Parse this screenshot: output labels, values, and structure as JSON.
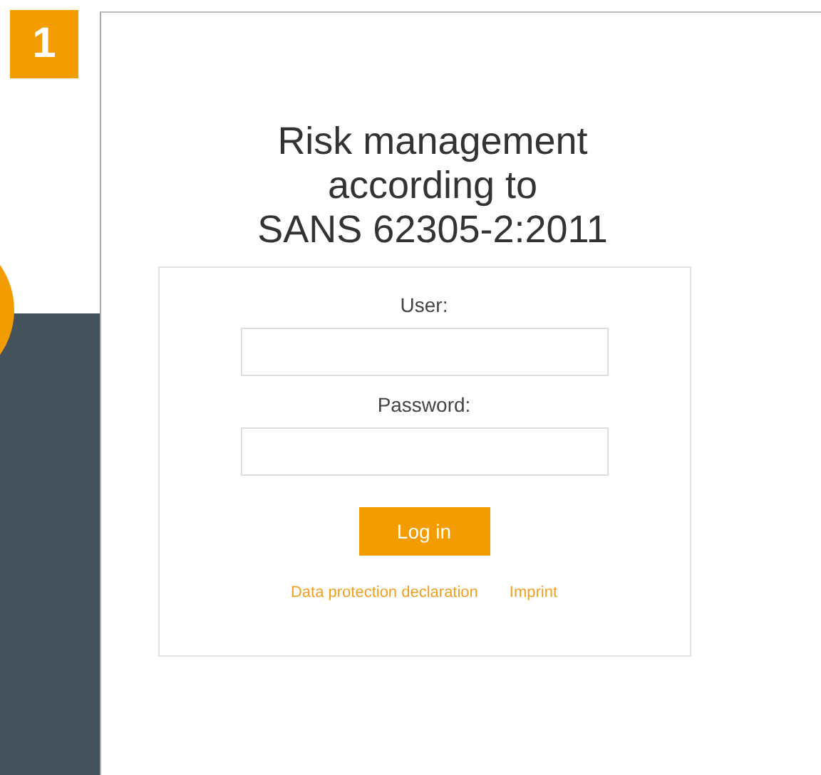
{
  "step_badge": "1",
  "login_page": {
    "title_lines": [
      "Risk management",
      "according to",
      "SANS 62305-2:2011"
    ],
    "fields": [
      {
        "label": "User:"
      },
      {
        "label": "Password:"
      }
    ],
    "login_button": "Log in",
    "links": [
      "Data protection declaration",
      "Imprint"
    ]
  }
}
